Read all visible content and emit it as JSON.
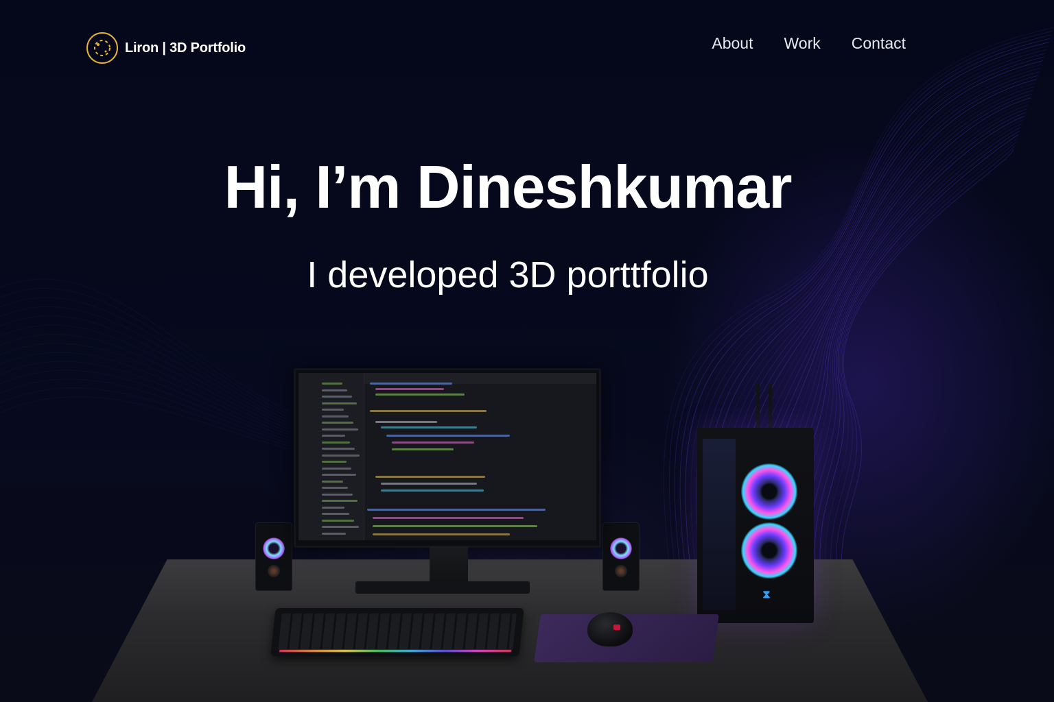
{
  "header": {
    "logo_text": "Liron | 3D Portfolio",
    "logo_icon": "orbit-logo-icon",
    "nav": [
      {
        "label": "About"
      },
      {
        "label": "Work"
      },
      {
        "label": "Contact"
      }
    ]
  },
  "hero": {
    "title": "Hi, I’m Dineshkumar",
    "subtitle": "I developed 3D porttfolio"
  },
  "colors": {
    "background": "#060816",
    "accent_gold": "#e4b53a",
    "wave_purple": "#5a3cd6",
    "text": "#ffffff"
  }
}
